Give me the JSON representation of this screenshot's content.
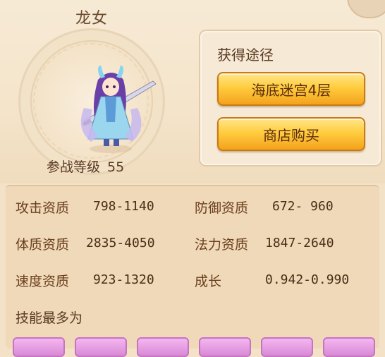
{
  "pet": {
    "name": "龙女",
    "combat_level_label": "参战等级",
    "combat_level_value": "55"
  },
  "obtain": {
    "title": "获得途径",
    "buttons": [
      "海底迷宫4层",
      "商店购买"
    ]
  },
  "stats": [
    {
      "label": "攻击资质",
      "value": "798-1140"
    },
    {
      "label": "防御资质",
      "value": "672- 960"
    },
    {
      "label": "体质资质",
      "value": "2835-4050"
    },
    {
      "label": "法力资质",
      "value": "1847-2640"
    },
    {
      "label": "速度资质",
      "value": "923-1320"
    },
    {
      "label": "成长",
      "value": "0.942-0.990"
    }
  ],
  "skills": {
    "heading": "技能最多为"
  },
  "colors": {
    "button_gold": "#ffcd3f",
    "panel_bg": "#efd9b9",
    "skill_slot": "#e39be0"
  }
}
